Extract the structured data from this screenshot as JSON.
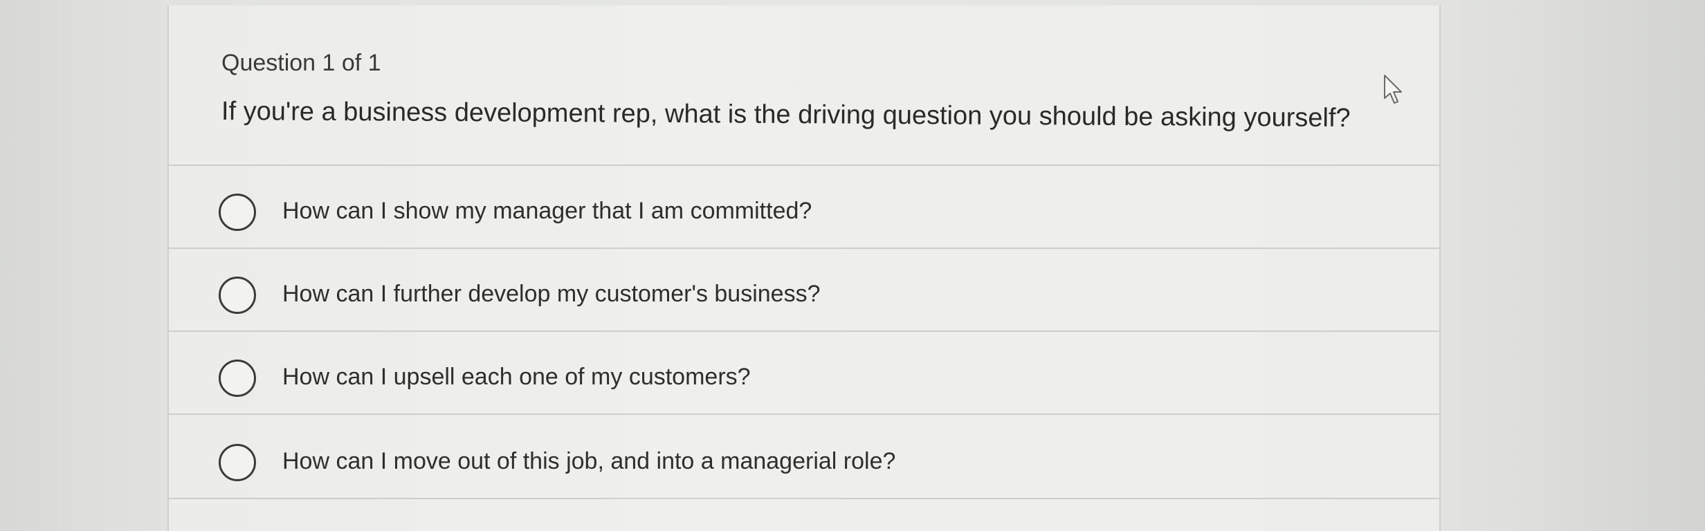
{
  "quiz": {
    "counter": "Question 1 of 1",
    "question": "If you're a business development rep, what is the driving question you should be asking yourself?",
    "options": [
      {
        "label": "How can I show my manager that I am committed?"
      },
      {
        "label": "How can I further develop my customer's business?"
      },
      {
        "label": "How can I upsell each one of my customers?"
      },
      {
        "label": "How can I move out of this job, and into a managerial role?"
      }
    ]
  },
  "cursor": {
    "icon": "arrow-pointer-icon"
  }
}
